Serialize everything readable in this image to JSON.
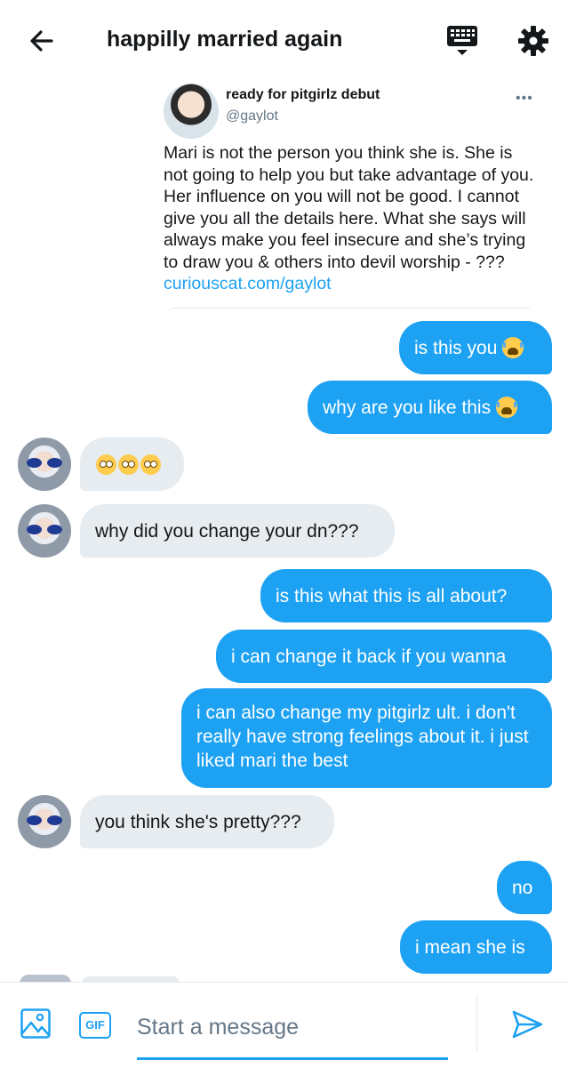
{
  "header": {
    "title": "happilly married again",
    "back_icon": "arrow-left-icon",
    "keyboard_icon": "keyboard-icon",
    "settings_icon": "gear-icon"
  },
  "tweet": {
    "name": "ready for pitgirlz debut",
    "handle": "@gaylot",
    "more": "•••",
    "text": "Mari is not the person you think she is. She is not going to help you but take advantage of you. Her influence on you will not be good. I cannot give you all the details here. What she says will always make you feel insecure and she’s trying to draw you & others into devil worship  - ???",
    "link": "curiouscat.com/gaylot"
  },
  "messages": [
    {
      "text": "is this you",
      "emoji": "loudly-crying-face"
    },
    {
      "text": "why are you like this",
      "emoji": "loudly-crying-face"
    },
    {
      "text": "",
      "emoji": "face-with-rolling-eyes x3"
    },
    {
      "text": "why did you change your dn???"
    },
    {
      "text": "is this what this is all about?"
    },
    {
      "text": "i can change it back if you wanna"
    },
    {
      "text": "i can also change my pitgirlz ult. i don't really have strong feelings about it. i just liked mari the best"
    },
    {
      "text": "you think she's pretty???"
    },
    {
      "text": "no"
    },
    {
      "text": "i mean she is"
    }
  ],
  "composer": {
    "placeholder": "Start a message",
    "gif_label": "GIF",
    "image_icon": "image-icon",
    "send_icon": "send-icon"
  },
  "colors": {
    "accent": "#1da1f2",
    "received_bubble": "#e6ecf0",
    "text": "#14171a",
    "secondary_text": "#657786"
  }
}
